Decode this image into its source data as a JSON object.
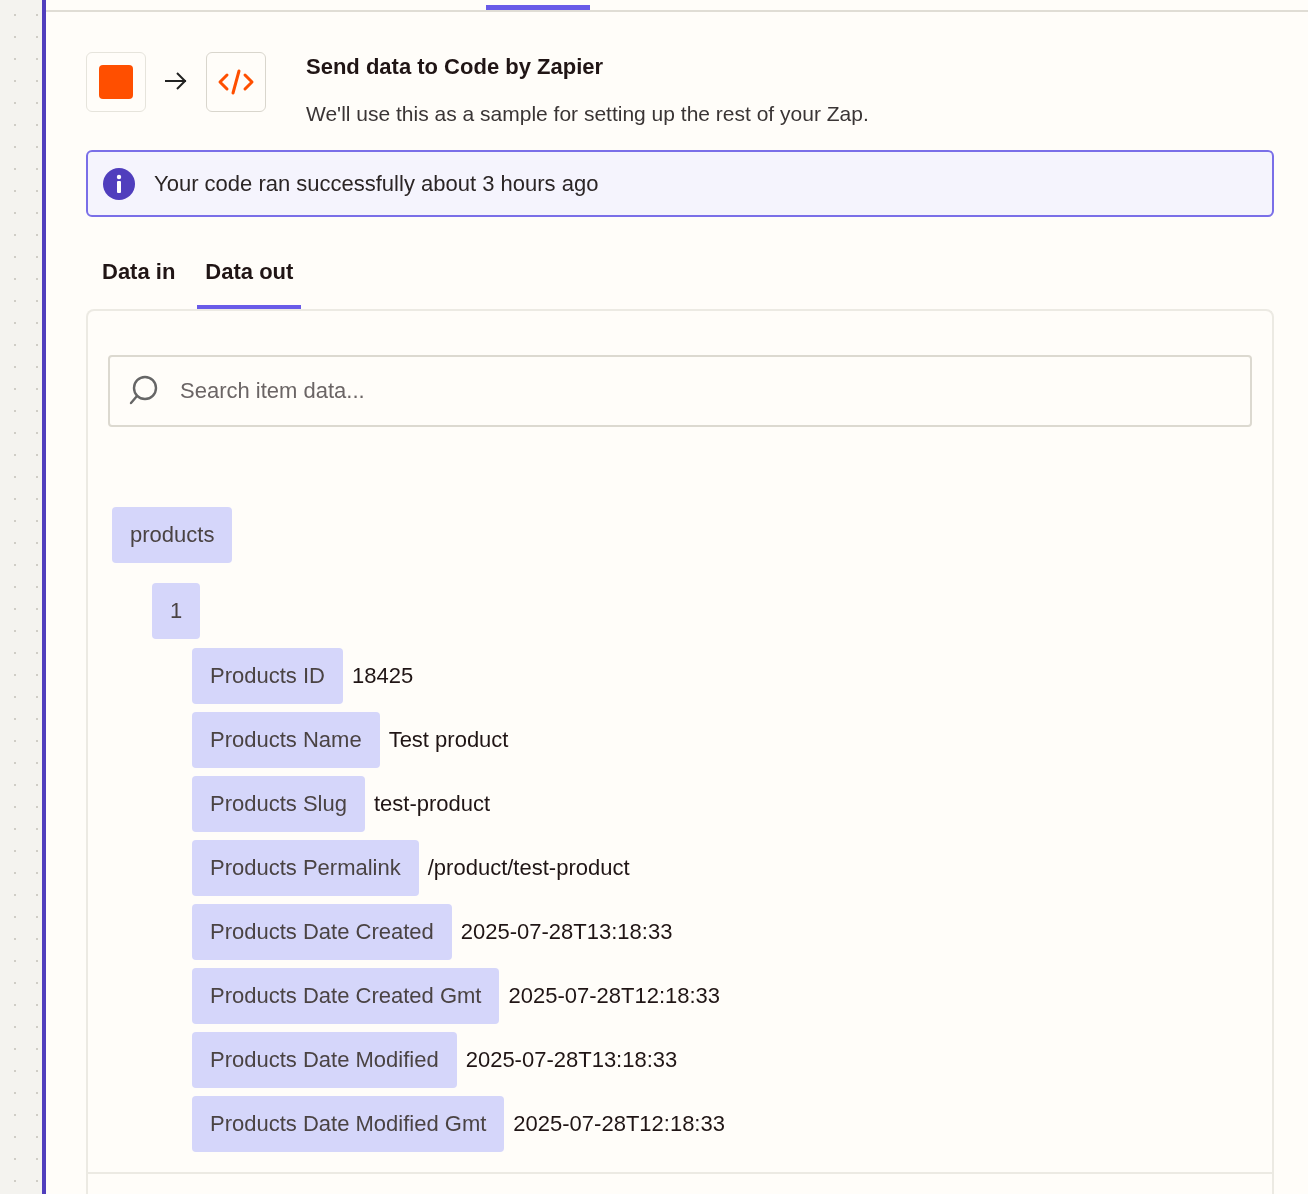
{
  "header": {
    "title": "Send data to Code by Zapier",
    "subtitle": "We'll use this as a sample for setting up the rest of your Zap."
  },
  "info_banner": {
    "text": "Your code ran successfully about 3 hours ago"
  },
  "tabs": [
    {
      "label": "Data in",
      "selected": false
    },
    {
      "label": "Data out",
      "selected": true
    }
  ],
  "search": {
    "placeholder": "Search item data..."
  },
  "tree": [
    {
      "key": "products",
      "children": [
        {
          "key": "1",
          "children": [
            {
              "key": "Products ID",
              "value": "18425"
            },
            {
              "key": "Products Name",
              "value": "Test product"
            },
            {
              "key": "Products Slug",
              "value": "test-product"
            },
            {
              "key": "Products Permalink",
              "value": "/product/test-product"
            },
            {
              "key": "Products Date Created",
              "value": "2025-07-28T13:18:33"
            },
            {
              "key": "Products Date Created Gmt",
              "value": "2025-07-28T12:18:33"
            },
            {
              "key": "Products Date Modified",
              "value": "2025-07-28T13:18:33"
            },
            {
              "key": "Products Date Modified Gmt",
              "value": "2025-07-28T12:18:33"
            }
          ]
        }
      ]
    }
  ]
}
